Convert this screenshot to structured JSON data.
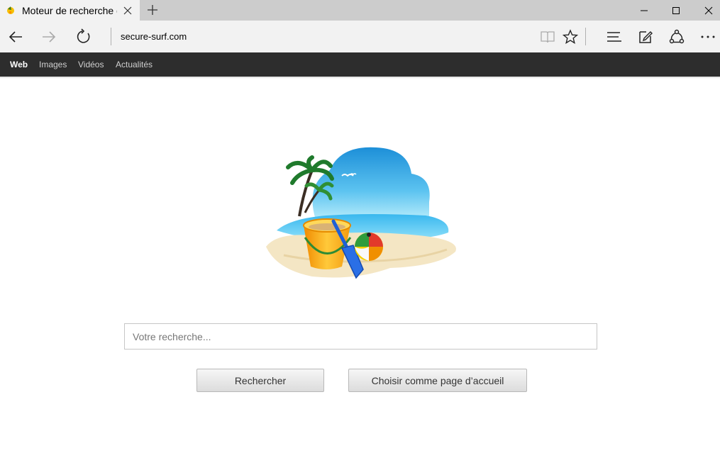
{
  "browser": {
    "tab_title": "Moteur de recherche gr",
    "address": "secure-surf.com"
  },
  "sitenav": {
    "items": [
      "Web",
      "Images",
      "Vidéos",
      "Actualités"
    ]
  },
  "search": {
    "placeholder": "Votre recherche...",
    "search_button": "Rechercher",
    "homepage_button": "Choisir comme page d’accueil"
  },
  "icons": {
    "tab_favicon": "beach-favicon-icon",
    "tab_close": "close-icon",
    "new_tab": "plus-icon",
    "back": "back-arrow-icon",
    "forward": "forward-arrow-icon",
    "refresh": "refresh-icon",
    "reading_view": "book-icon",
    "favorite": "star-icon",
    "hub": "hub-icon",
    "web_note": "pen-note-icon",
    "share": "share-icon",
    "more": "more-icon"
  }
}
